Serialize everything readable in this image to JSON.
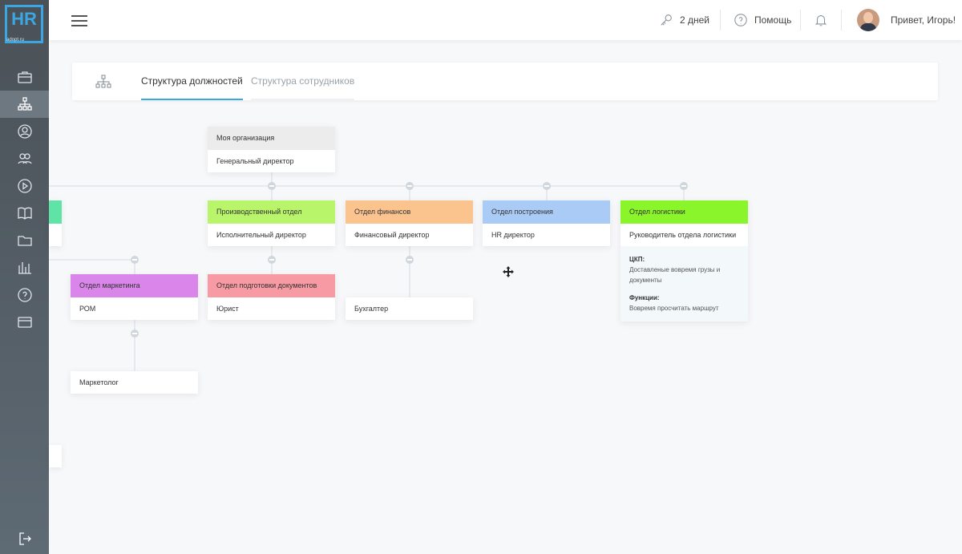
{
  "logo": {
    "main": "HR",
    "sub": "adopt.ru"
  },
  "sidebar": {
    "items": [
      {
        "name": "briefcase-icon"
      },
      {
        "name": "org-structure-icon",
        "active": true
      },
      {
        "name": "user-icon"
      },
      {
        "name": "users-icon"
      },
      {
        "name": "play-icon"
      },
      {
        "name": "book-icon"
      },
      {
        "name": "folder-icon"
      },
      {
        "name": "chart-icon"
      },
      {
        "name": "help-icon"
      },
      {
        "name": "card-icon"
      }
    ],
    "logout": "logout-icon"
  },
  "topbar": {
    "trial_days": "2 дней",
    "help_label": "Помощь",
    "greeting": "Привет, Игорь!"
  },
  "tabs": [
    {
      "label": "Структура должностей",
      "active": true
    },
    {
      "label": "Структура сотрудников",
      "active": false
    }
  ],
  "org": {
    "root": {
      "head": "Моя организация",
      "body": "Генеральный директор"
    },
    "departments": [
      {
        "head": "Производственный отдел",
        "body": "Исполнительный директор",
        "color": "#b8f56a"
      },
      {
        "head": "Отдел финансов",
        "body": "Финансовый директор",
        "color": "#fbc48e"
      },
      {
        "head": "Отдел построения",
        "body": "HR директор",
        "color": "#a9cbf6"
      },
      {
        "head": "Отдел логистики",
        "body": "Руководитель отдела логистики",
        "color": "#8af52a",
        "details": {
          "ckp_label": "ЦКП:",
          "ckp_text": "Доставленые вовремя грузы и документы",
          "func_label": "Функции:",
          "func_text": "Вовремя просчитать маршрут"
        }
      }
    ],
    "sub": [
      {
        "head": "Отдел маркетинга",
        "body": "РОМ",
        "color": "#da85ea"
      },
      {
        "head": "Отдел подготовки документов",
        "body": "Юрист",
        "color": "#f79aa3"
      }
    ],
    "leaves": [
      {
        "body": "Бухгалтер"
      },
      {
        "body": "Маркетолог"
      }
    ],
    "partial_left_color": "#5fe3a6"
  }
}
